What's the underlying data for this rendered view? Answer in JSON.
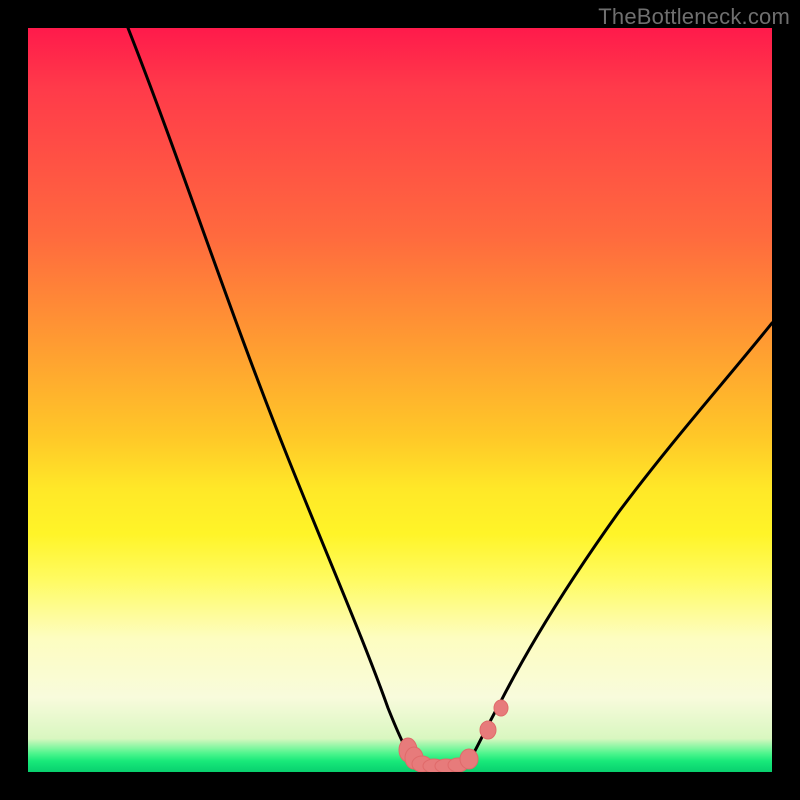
{
  "watermark": "TheBottleneck.com",
  "colors": {
    "frame": "#000000",
    "curve": "#000000",
    "marker_fill": "#e77b7b",
    "marker_stroke": "#e06a6a"
  },
  "chart_data": {
    "type": "line",
    "title": "",
    "xlabel": "",
    "ylabel": "",
    "xlim": [
      0,
      100
    ],
    "ylim": [
      0,
      100
    ],
    "grid": false,
    "legend": false,
    "note": "Values estimated from pixel positions; no axis ticks present in image.",
    "series": [
      {
        "name": "left-curve",
        "x": [
          14.0,
          20.0,
          25.0,
          30.0,
          35.0,
          40.0,
          44.0,
          47.0,
          49.0,
          50.5,
          51.6
        ],
        "values": [
          100.0,
          82.0,
          67.0,
          53.0,
          40.0,
          28.0,
          18.0,
          11.0,
          6.0,
          3.0,
          2.0
        ]
      },
      {
        "name": "right-curve",
        "x": [
          59.5,
          61.0,
          63.5,
          67.0,
          72.0,
          78.0,
          85.0,
          92.0,
          100.0
        ],
        "values": [
          2.0,
          4.0,
          9.0,
          16.0,
          25.0,
          35.0,
          45.0,
          53.0,
          61.0
        ]
      },
      {
        "name": "markers",
        "style": "points",
        "x": [
          51.6,
          52.5,
          54.0,
          55.5,
          57.0,
          58.5,
          59.5,
          62.0,
          63.5
        ],
        "values": [
          2.0,
          1.2,
          0.9,
          0.9,
          0.9,
          1.1,
          2.0,
          6.0,
          9.0
        ]
      }
    ]
  }
}
